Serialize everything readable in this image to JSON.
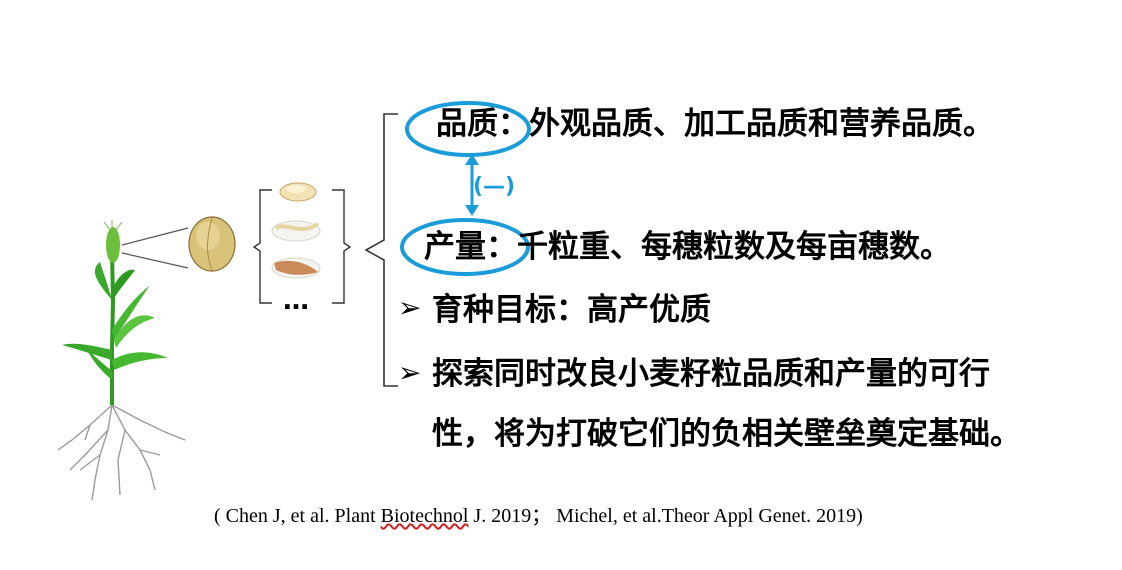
{
  "quality": {
    "label": "品质：",
    "text": "外观品质、加工品质和营养品质。"
  },
  "negative_correlation": "(—)",
  "yield": {
    "label": "产量：",
    "text": "千粒重、每穗粒数及每亩穗数。"
  },
  "bullets": [
    {
      "text": "育种目标：高产优质"
    },
    {
      "text_line1": "探索同时改良小麦籽粒品质和产量的可行",
      "text_line2": "性，将为打破它们的负相关壁垒奠定基础。"
    }
  ],
  "products_ellipsis": "…",
  "reference": {
    "part1": "( Chen J, et al. Plant ",
    "part2": "Biotechnol",
    "part3": " J. 2019； Michel, et al.Theor Appl Genet. 2019)"
  },
  "colors": {
    "accent": "#1a9cd8",
    "text": "#000000",
    "plant_green": "#3aa82a"
  },
  "icons": [
    "wheat-plant-icon",
    "wheat-grain-icon",
    "flour-icon",
    "noodle-icon",
    "bread-icon",
    "arrow-bullet-icon"
  ]
}
